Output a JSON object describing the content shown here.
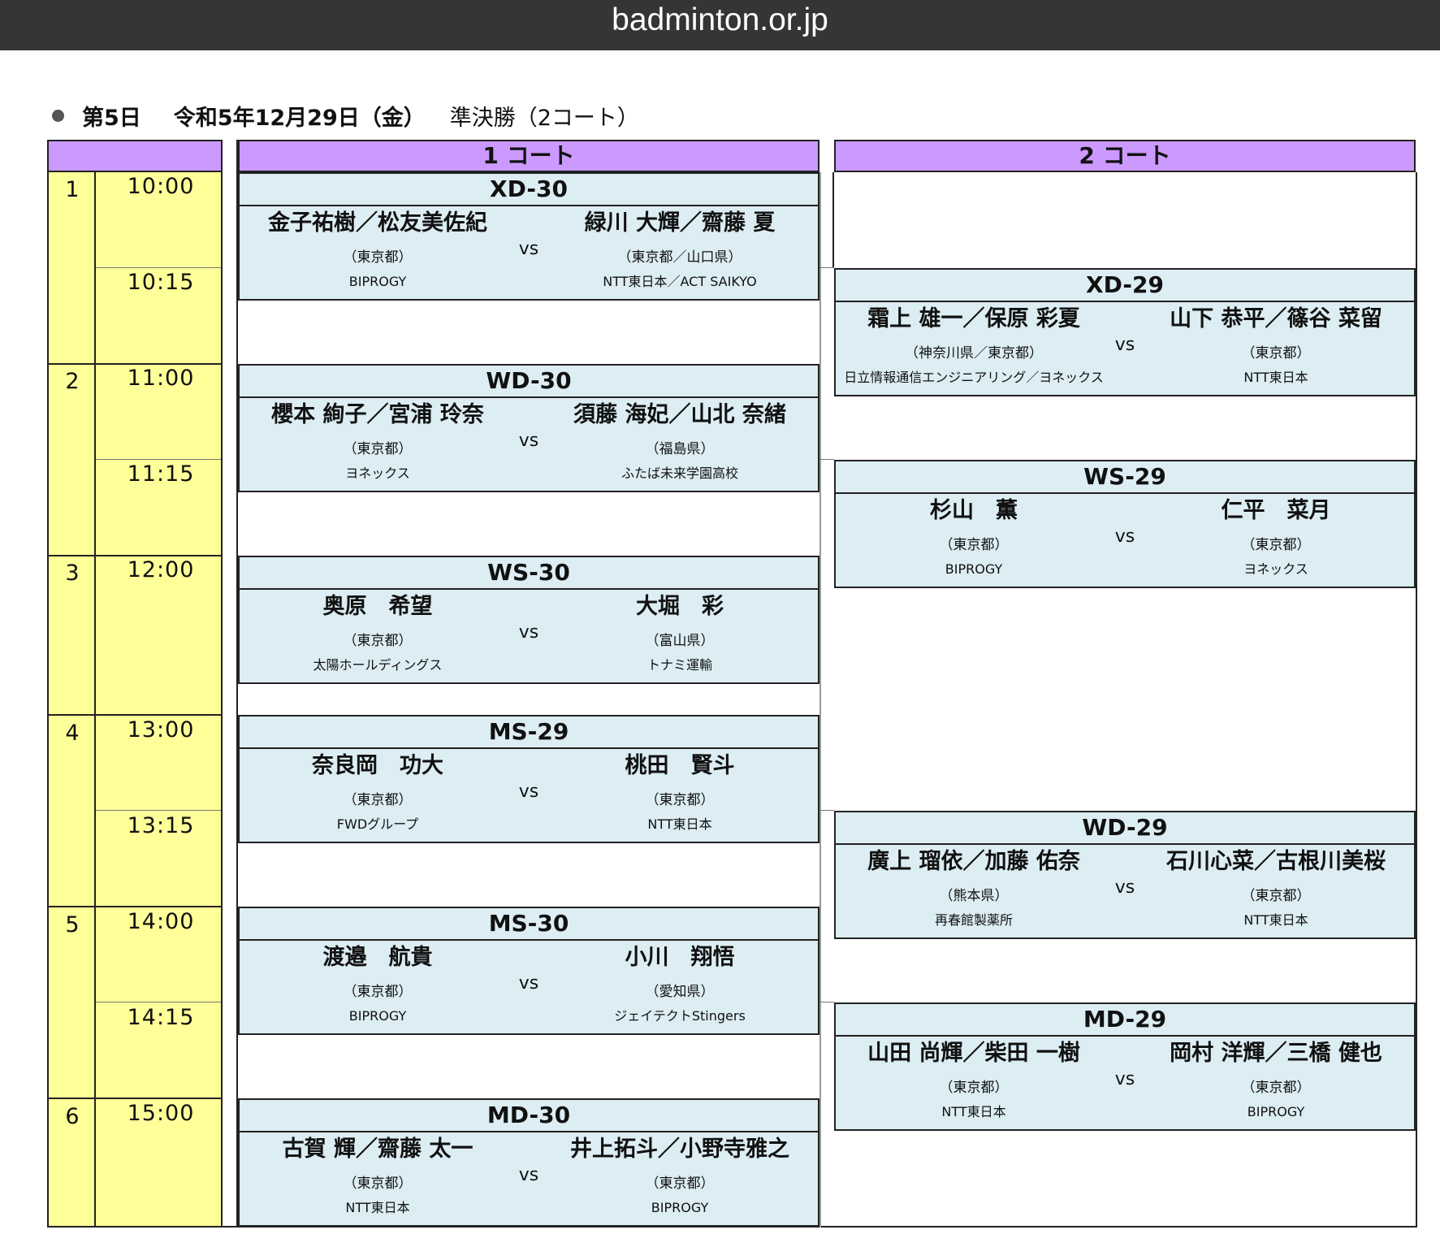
{
  "browser": {
    "url": "badminton.or.jp"
  },
  "heading": {
    "day": "第5日",
    "date": "令和5年12月29日（金）",
    "round": "準決勝（2コート）"
  },
  "courts": {
    "court1": "1 コート",
    "court2": "2 コート"
  },
  "slots": [
    {
      "num": "1",
      "times": [
        "10:00",
        "10:15"
      ]
    },
    {
      "num": "2",
      "times": [
        "11:00",
        "11:15"
      ]
    },
    {
      "num": "3",
      "times": [
        "12:00"
      ]
    },
    {
      "num": "4",
      "times": [
        "13:00",
        "13:15"
      ]
    },
    {
      "num": "5",
      "times": [
        "14:00",
        "14:15"
      ]
    },
    {
      "num": "6",
      "times": [
        "15:00"
      ]
    }
  ],
  "vs_label": "vs",
  "matches": [
    {
      "code": "XD-30",
      "left": {
        "name": "金子祐樹／松友美佐紀",
        "pref": "（東京都）",
        "club": "BIPROGY"
      },
      "right": {
        "name": "緑川 大輝／齋藤 夏",
        "pref": "（東京都／山口県）",
        "club": "NTT東日本／ACT SAIKYO"
      }
    },
    {
      "code": "XD-29",
      "left": {
        "name": "霜上 雄一／保原 彩夏",
        "pref": "（神奈川県／東京都）",
        "club": "日立情報通信エンジニアリング／ヨネックス"
      },
      "right": {
        "name": "山下 恭平／篠谷 菜留",
        "pref": "（東京都）",
        "club": "NTT東日本"
      }
    },
    {
      "code": "WD-30",
      "left": {
        "name": "櫻本 絢子／宮浦 玲奈",
        "pref": "（東京都）",
        "club": "ヨネックス"
      },
      "right": {
        "name": "須藤 海妃／山北 奈緒",
        "pref": "（福島県）",
        "club": "ふたば未来学園高校"
      }
    },
    {
      "code": "WS-29",
      "left": {
        "name": "杉山　薫",
        "pref": "（東京都）",
        "club": "BIPROGY"
      },
      "right": {
        "name": "仁平　菜月",
        "pref": "（東京都）",
        "club": "ヨネックス"
      }
    },
    {
      "code": "WS-30",
      "left": {
        "name": "奥原　希望",
        "pref": "（東京都）",
        "club": "太陽ホールディングス"
      },
      "right": {
        "name": "大堀　彩",
        "pref": "（富山県）",
        "club": "トナミ運輸"
      }
    },
    {
      "code": "MS-29",
      "left": {
        "name": "奈良岡　功大",
        "pref": "（東京都）",
        "club": "FWDグループ"
      },
      "right": {
        "name": "桃田　賢斗",
        "pref": "（東京都）",
        "club": "NTT東日本"
      }
    },
    {
      "code": "WD-29",
      "left": {
        "name": "廣上 瑠依／加藤 佑奈",
        "pref": "（熊本県）",
        "club": "再春館製薬所"
      },
      "right": {
        "name": "石川心菜／古根川美桜",
        "pref": "（東京都）",
        "club": "NTT東日本"
      }
    },
    {
      "code": "MS-30",
      "left": {
        "name": "渡邉　航貴",
        "pref": "（東京都）",
        "club": "BIPROGY"
      },
      "right": {
        "name": "小川　翔悟",
        "pref": "（愛知県）",
        "club": "ジェイテクトStingers"
      }
    },
    {
      "code": "MD-29",
      "left": {
        "name": "山田 尚輝／柴田 一樹",
        "pref": "（東京都）",
        "club": "NTT東日本"
      },
      "right": {
        "name": "岡村 洋輝／三橋 健也",
        "pref": "（東京都）",
        "club": "BIPROGY"
      }
    },
    {
      "code": "MD-30",
      "left": {
        "name": "古賀 輝／齋藤 太一",
        "pref": "（東京都）",
        "club": "NTT東日本"
      },
      "right": {
        "name": "井上拓斗／小野寺雅之",
        "pref": "（東京都）",
        "club": "BIPROGY"
      }
    }
  ],
  "colors": {
    "header": "#cc99ff",
    "time_column": "#ffff99",
    "match_box": "#dcedf3",
    "topbar": "#353535"
  }
}
